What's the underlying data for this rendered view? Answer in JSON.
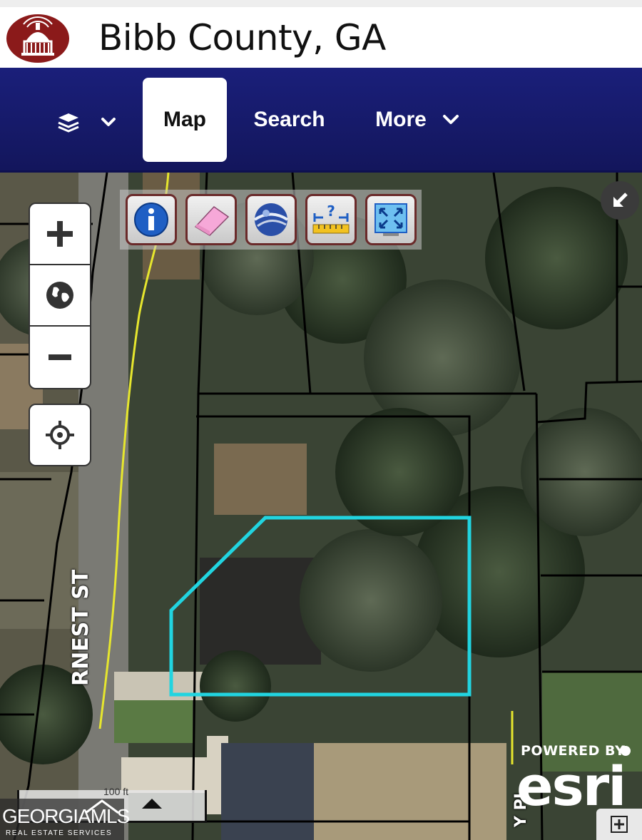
{
  "header": {
    "title": "Bibb County, GA",
    "logo_icon": "capitol-dome-logo",
    "logo_color": "#8b1a1a"
  },
  "nav": {
    "layers_icon": "layers-icon",
    "tabs": [
      {
        "label": "Map",
        "active": true
      },
      {
        "label": "Search",
        "active": false
      },
      {
        "label": "More",
        "active": false,
        "dropdown": true
      }
    ],
    "bar_color": "#1a1f7a"
  },
  "map": {
    "toolbar": [
      {
        "icon": "info-icon"
      },
      {
        "icon": "eraser-icon"
      },
      {
        "icon": "globe-icon"
      },
      {
        "icon": "measure-icon"
      },
      {
        "icon": "full-extent-icon"
      }
    ],
    "zoom_controls": [
      "zoom-in",
      "home-extent",
      "zoom-out"
    ],
    "locate_icon": "locate-crosshair-icon",
    "streets": [
      {
        "label": "RNEST ST"
      },
      {
        "label": "Y PL"
      }
    ],
    "parcel_highlight_color": "#21d4e0",
    "parcel_line_color": "#000000",
    "road_line_color": "#e6e62e",
    "attribution": {
      "powered_by": "POWERED BY",
      "brand": "esri"
    },
    "watermark": {
      "name": "GEORGIAMLS",
      "subtitle": "REAL ESTATE SERVICES"
    },
    "scale_label": "100 ft"
  }
}
